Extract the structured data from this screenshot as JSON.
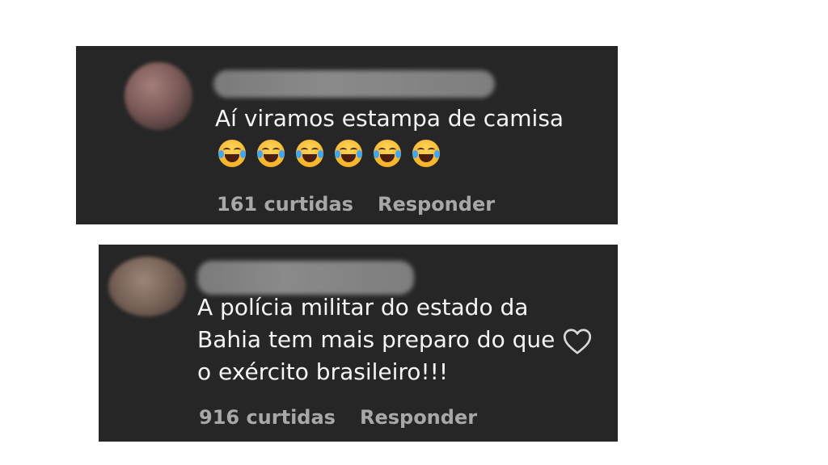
{
  "comments": [
    {
      "text": "Aí viramos estampa de camisa",
      "emojis": [
        "face-with-tears-of-joy",
        "face-with-tears-of-joy",
        "face-with-tears-of-joy",
        "face-with-tears-of-joy",
        "face-with-tears-of-joy",
        "face-with-tears-of-joy"
      ],
      "likes": "161 curtidas",
      "reply": "Responder"
    },
    {
      "text": "A polícia militar do estado da\nBahia tem mais preparo do que\no exército brasileiro!!!",
      "likes": "916 curtidas",
      "reply": "Responder",
      "like_icon": "heart-icon"
    }
  ],
  "colors": {
    "card_bg": "#262626",
    "text": "#f5f5f5",
    "meta_text": "#a8a8a8"
  }
}
